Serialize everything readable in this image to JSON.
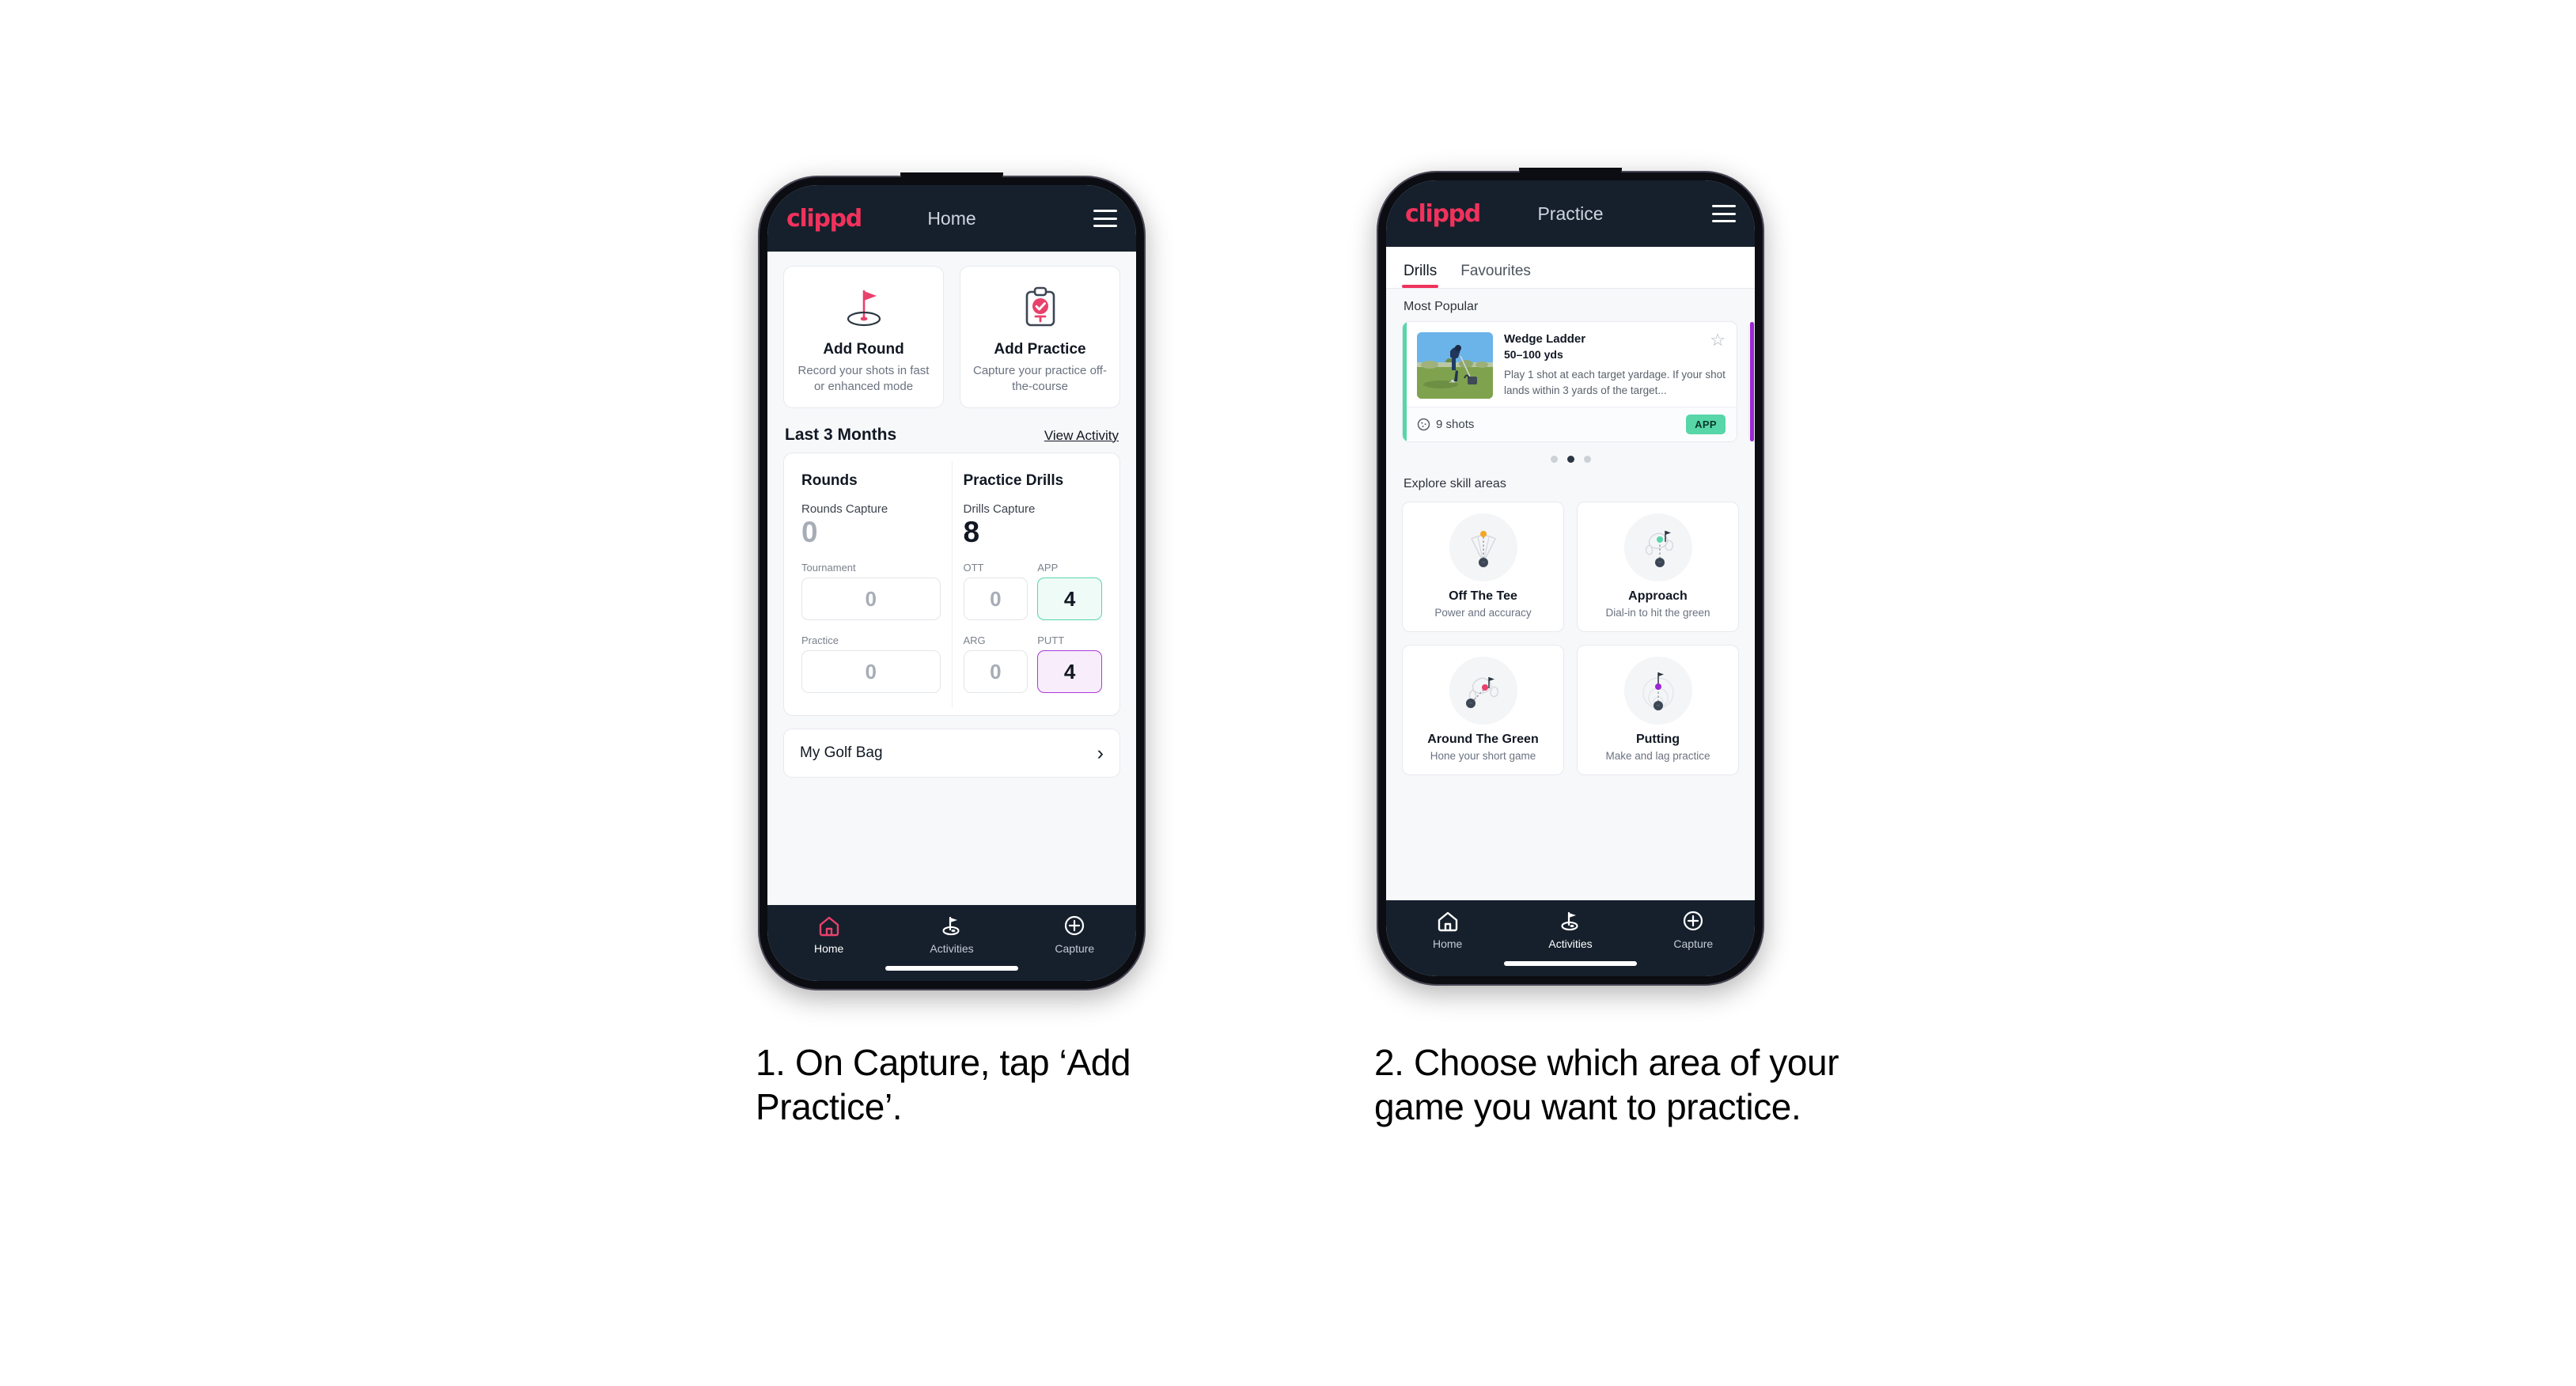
{
  "phone1": {
    "appbar": {
      "logo": "clippd",
      "title": "Home",
      "menu_icon": "hamburger-icon"
    },
    "actions": [
      {
        "icon": "golf-flag-hole-icon",
        "title": "Add Round",
        "sub": "Record your shots in fast or enhanced mode"
      },
      {
        "icon": "clipboard-check-tee-icon",
        "title": "Add Practice",
        "sub": "Capture your practice off-the-course"
      }
    ],
    "section": {
      "title": "Last 3 Months",
      "link": "View Activity"
    },
    "stats": {
      "rounds": {
        "heading": "Rounds",
        "capture_label": "Rounds Capture",
        "capture_value": "0",
        "items": [
          {
            "label": "Tournament",
            "value": "0",
            "state": "plain"
          },
          {
            "label": "Practice",
            "value": "0",
            "state": "plain"
          }
        ]
      },
      "drills": {
        "heading": "Practice Drills",
        "capture_label": "Drills Capture",
        "capture_value": "8",
        "items": [
          {
            "label": "OTT",
            "value": "0",
            "state": "plain"
          },
          {
            "label": "APP",
            "value": "4",
            "state": "green"
          },
          {
            "label": "ARG",
            "value": "0",
            "state": "plain"
          },
          {
            "label": "PUTT",
            "value": "4",
            "state": "purple"
          }
        ]
      }
    },
    "golf_bag": {
      "label": "My Golf Bag",
      "chevron": "chevron-right-icon"
    },
    "nav": [
      {
        "icon": "home-icon",
        "label": "Home",
        "active": true
      },
      {
        "icon": "golf-flag-icon",
        "label": "Activities",
        "active": false
      },
      {
        "icon": "plus-circle-icon",
        "label": "Capture",
        "active": false
      }
    ]
  },
  "phone2": {
    "appbar": {
      "logo": "clippd",
      "title": "Practice",
      "menu_icon": "hamburger-icon"
    },
    "tabs": [
      {
        "label": "Drills",
        "active": true
      },
      {
        "label": "Favourites",
        "active": false
      }
    ],
    "most_popular_label": "Most Popular",
    "drill": {
      "name": "Wedge Ladder",
      "yardage": "50–100 yds",
      "description": "Play 1 shot at each target yardage. If your shot lands within 3 yards of the target...",
      "shots": "9 shots",
      "shots_icon": "clock-icon",
      "badge": "APP",
      "star_icon": "star-outline-icon",
      "accent_color": "#57d6a8",
      "next_accent_color": "#9b27d4"
    },
    "carousel_dots": {
      "count": 3,
      "active_index": 1
    },
    "explore_label": "Explore skill areas",
    "skills": [
      {
        "icon": "off-the-tee-icon",
        "name": "Off The Tee",
        "sub": "Power and accuracy",
        "dot_color": "#f5a623"
      },
      {
        "icon": "approach-icon",
        "name": "Approach",
        "sub": "Dial-in to hit the green",
        "dot_color": "#57d6a8"
      },
      {
        "icon": "around-the-green-icon",
        "name": "Around The Green",
        "sub": "Hone your short game",
        "dot_color": "#e8416b"
      },
      {
        "icon": "putting-icon",
        "name": "Putting",
        "sub": "Make and lag practice",
        "dot_color": "#9b27d4"
      }
    ],
    "nav": [
      {
        "icon": "home-icon",
        "label": "Home",
        "active": false
      },
      {
        "icon": "golf-flag-icon",
        "label": "Activities",
        "active": true
      },
      {
        "icon": "plus-circle-icon",
        "label": "Capture",
        "active": false
      }
    ]
  },
  "captions": {
    "one": "1. On Capture, tap ‘Add Practice’.",
    "two": "2. Choose which area of your game you want to practice."
  },
  "colors": {
    "brand_pink": "#f0325c",
    "header_dark": "#16202c",
    "app_green": "#57d6a8",
    "putt_purple": "#a93bd8",
    "page_bg": "#f7f8fa"
  }
}
